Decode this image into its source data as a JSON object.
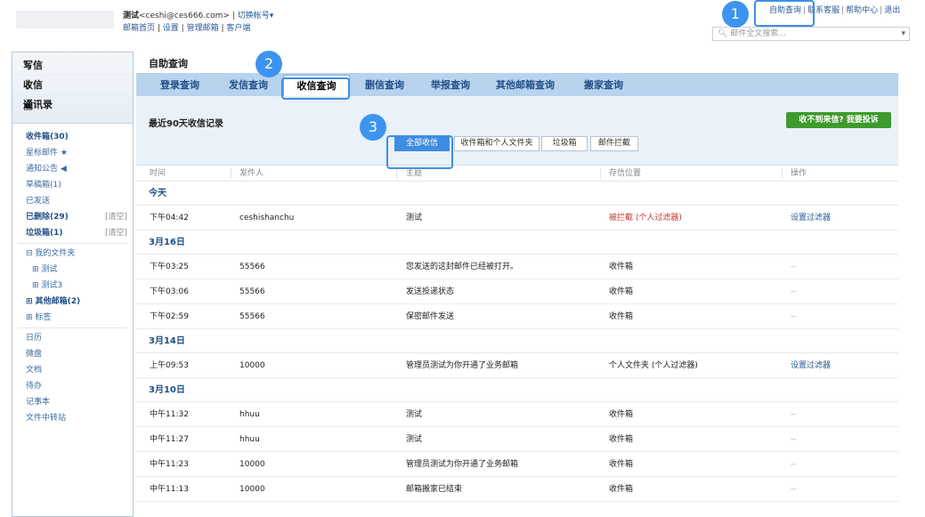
{
  "header": {
    "user_name": "测试",
    "user_email": "<ceshi@ces666.com>",
    "switch_account": "切换帐号",
    "switch_caret": "▾",
    "sub_links": [
      "邮箱首页",
      "设置",
      "管理邮箱",
      "客户端"
    ],
    "top_links": [
      "自助查询",
      "联系客服",
      "帮助中心",
      "退出"
    ],
    "search_placeholder": "邮件全文搜索...",
    "search_icon": "magnifier"
  },
  "callouts": [
    "1",
    "2",
    "3"
  ],
  "sidebar": {
    "compose": [
      {
        "icon": "pen-icon",
        "glyph": "✎",
        "label": "写信"
      },
      {
        "icon": "inbox-icon",
        "glyph": "⇩",
        "label": "收信"
      },
      {
        "icon": "contacts-icon",
        "glyph": "▣",
        "label": "通讯录"
      }
    ],
    "folders": [
      {
        "label": "收件箱(30)",
        "bold": true
      },
      {
        "label": "星标邮件 ★"
      },
      {
        "label": "通知公告 ◀"
      },
      {
        "label": "草稿箱(1)"
      },
      {
        "label": "已发送"
      },
      {
        "label": "已删除(29)",
        "bold": true,
        "action": "[清空]"
      },
      {
        "label": "垃圾箱(1)",
        "bold": true,
        "action": "[清空]"
      }
    ],
    "myfolders": [
      {
        "label": "⊟ 我的文件夹"
      },
      {
        "label": "⊞ 测试",
        "sub": true
      },
      {
        "label": "⊞ 测试3",
        "sub": true
      },
      {
        "label": "⊞ 其他邮箱(2)",
        "bold": true
      },
      {
        "label": "⊞ 标签"
      }
    ],
    "tools": [
      "日历",
      "微盘",
      "文档",
      "待办",
      "记事本",
      "文件中转站"
    ]
  },
  "main": {
    "title": "自助查询",
    "tabs": [
      "登录查询",
      "发信查询",
      "收信查询",
      "删信查询",
      "举报查询",
      "其他邮箱查询",
      "搬家查询"
    ],
    "active_tab": 2,
    "panel_title": "最近90天收信记录",
    "complain_button": "收不到来信? 我要投诉",
    "filters": [
      "全部收信",
      "收件箱和个人文件夹",
      "垃圾箱",
      "邮件拦截"
    ],
    "active_filter": 0,
    "columns": [
      "时间",
      "发件人",
      "主题",
      "存信位置",
      "操作"
    ],
    "groups": [
      {
        "date": "今天",
        "rows": [
          [
            "下午04:42",
            "ceshishanchu",
            "测试",
            "被拦截 (个人过滤器)",
            "设置过滤器"
          ]
        ]
      },
      {
        "date": "3月16日",
        "rows": [
          [
            "下午03:25",
            "55566",
            "您发送的这封邮件已经被打开。",
            "收件箱",
            "--"
          ],
          [
            "下午03:06",
            "55566",
            "发送投递状态",
            "收件箱",
            "--"
          ],
          [
            "下午02:59",
            "55566",
            "保密邮件发送",
            "收件箱",
            "--"
          ]
        ]
      },
      {
        "date": "3月14日",
        "rows": [
          [
            "上午09:53",
            "10000",
            "管理员测试为你开通了业务邮箱",
            "个人文件夹 (个人过滤器)",
            "设置过滤器"
          ]
        ]
      },
      {
        "date": "3月10日",
        "rows": [
          [
            "中午11:32",
            "hhuu",
            "测试",
            "收件箱",
            "--"
          ],
          [
            "中午11:27",
            "hhuu",
            "测试",
            "收件箱",
            "--"
          ],
          [
            "中午11:23",
            "10000",
            "管理员测试为你开通了业务邮箱",
            "收件箱",
            "--"
          ],
          [
            "中午11:13",
            "10000",
            "邮箱搬家已结束",
            "收件箱",
            "--"
          ]
        ]
      }
    ]
  },
  "colors": {
    "accent": "#3d94ee",
    "tab_bar": "#b7d3ee",
    "panel": "#e9f1f9",
    "complain": "#3e9a2d",
    "blocked": "#c0392b"
  }
}
